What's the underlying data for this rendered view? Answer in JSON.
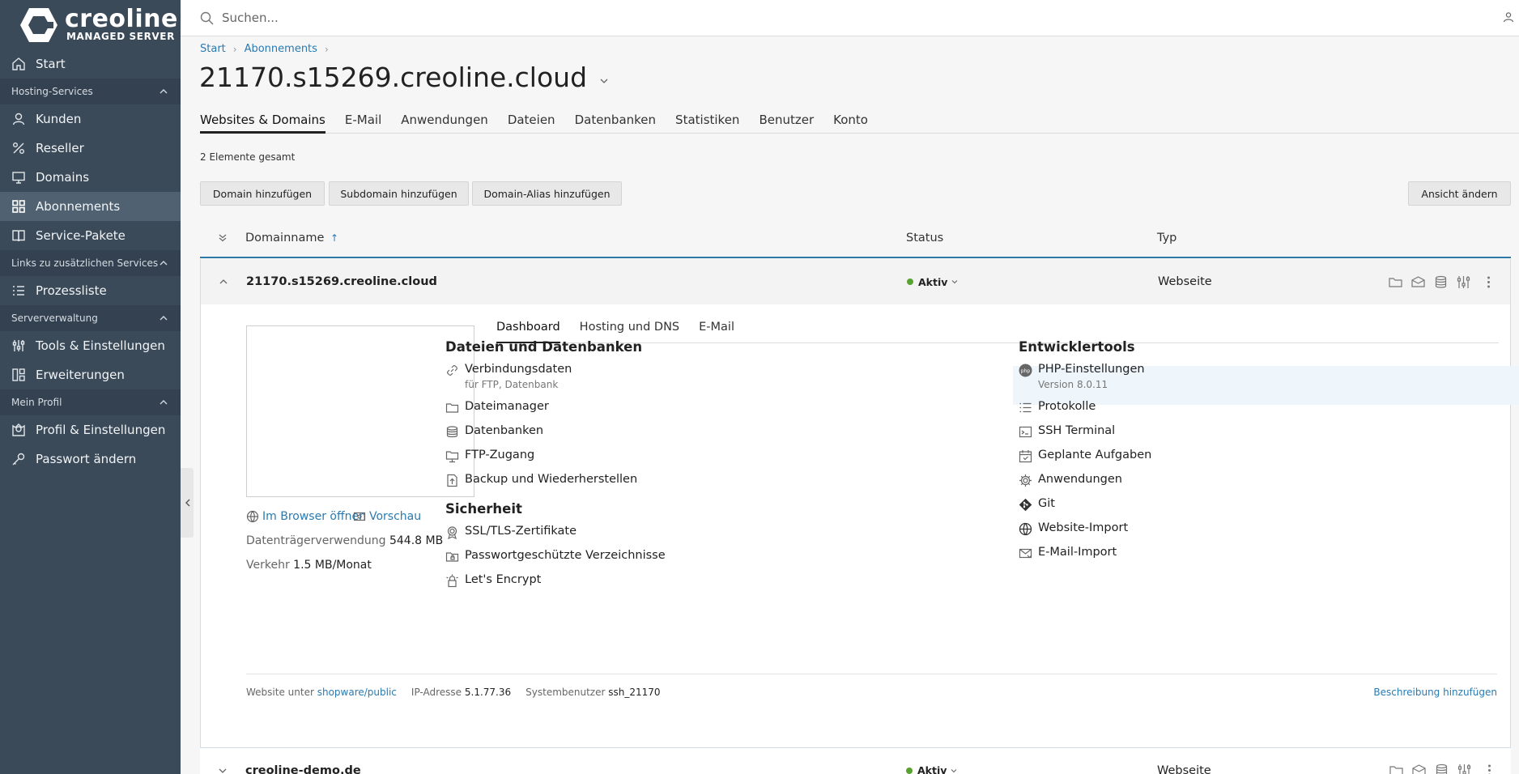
{
  "brand": {
    "name": "creoline",
    "subtitle": "MANAGED SERVER"
  },
  "sidebar": {
    "items": [
      {
        "label": "Start",
        "icon": "home-icon"
      },
      {
        "section": "Hosting-Services"
      },
      {
        "label": "Kunden",
        "icon": "user-icon"
      },
      {
        "label": "Reseller",
        "icon": "percent-icon"
      },
      {
        "label": "Domains",
        "icon": "monitor-icon"
      },
      {
        "label": "Abonnements",
        "icon": "grid-icon",
        "active": true
      },
      {
        "label": "Service-Pakete",
        "icon": "book-icon"
      },
      {
        "section": "Links zu zusätzlichen Services"
      },
      {
        "label": "Prozessliste",
        "icon": "list-icon"
      },
      {
        "section": "Serververwaltung"
      },
      {
        "label": "Tools & Einstellungen",
        "icon": "sliders-icon"
      },
      {
        "label": "Erweiterungen",
        "icon": "extensions-icon"
      },
      {
        "section": "Mein Profil"
      },
      {
        "label": "Profil & Einstellungen",
        "icon": "profile-icon"
      },
      {
        "label": "Passwort ändern",
        "icon": "key-icon"
      }
    ]
  },
  "search": {
    "placeholder": "Suchen..."
  },
  "breadcrumb": [
    "Start",
    "Abonnements"
  ],
  "page": {
    "title": "21170.s15269.creoline.cloud"
  },
  "tabs": [
    "Websites & Domains",
    "E-Mail",
    "Anwendungen",
    "Dateien",
    "Datenbanken",
    "Statistiken",
    "Benutzer",
    "Konto"
  ],
  "items_count": "2 Elemente gesamt",
  "toolbar": {
    "add_domain": "Domain hinzufügen",
    "add_subdomain": "Subdomain hinzufügen",
    "add_alias": "Domain-Alias hinzufügen",
    "change_view": "Ansicht ändern"
  },
  "table": {
    "headers": {
      "name": "Domainname",
      "sort": "↑",
      "status": "Status",
      "type": "Typ"
    },
    "rows": [
      {
        "domain": "21170.s15269.creoline.cloud",
        "status": "Aktiv",
        "type": "Webseite"
      },
      {
        "domain": "creoline-demo.de",
        "status": "Aktiv",
        "type": "Webseite"
      }
    ]
  },
  "panel": {
    "open_browser": "Im Browser öffnen",
    "preview": "Vorschau",
    "disk_label": "Datenträgerverwendung",
    "disk_value": "544.8 MB",
    "traffic_label": "Verkehr",
    "traffic_value": "1.5 MB/Monat",
    "subtabs": [
      "Dashboard",
      "Hosting und DNS",
      "E-Mail"
    ],
    "files_title": "Dateien und Datenbanken",
    "files": [
      {
        "label": "Verbindungsdaten",
        "sub": "für FTP, Datenbank"
      },
      {
        "label": "Dateimanager"
      },
      {
        "label": "Datenbanken"
      },
      {
        "label": "FTP-Zugang"
      },
      {
        "label": "Backup und Wiederherstellen"
      }
    ],
    "security_title": "Sicherheit",
    "security": [
      {
        "label": "SSL/TLS-Zertifikate"
      },
      {
        "label": "Passwortgeschützte Verzeichnisse"
      },
      {
        "label": "Let's Encrypt"
      }
    ],
    "dev_title": "Entwicklertools",
    "dev": [
      {
        "label": "PHP-Einstellungen",
        "sub": "Version 8.0.11"
      },
      {
        "label": "Protokolle"
      },
      {
        "label": "SSH Terminal"
      },
      {
        "label": "Geplante Aufgaben"
      },
      {
        "label": "Anwendungen"
      },
      {
        "label": "Git"
      },
      {
        "label": "Website-Import"
      },
      {
        "label": "E-Mail-Import"
      }
    ],
    "footer": {
      "website_label": "Website unter",
      "website_path": "shopware/public",
      "ip_label": "IP-Adresse",
      "ip_value": "5.1.77.36",
      "user_label": "Systembenutzer",
      "user_value": "ssh_21170",
      "add_description": "Beschreibung hinzufügen"
    }
  },
  "colors": {
    "sidebar": "#3b4a59",
    "sidebar_section": "#334150",
    "sidebar_active": "#506172",
    "link": "#2a7ab0",
    "active_status": "#58a22f",
    "accent_border": "#2c7aa9"
  }
}
